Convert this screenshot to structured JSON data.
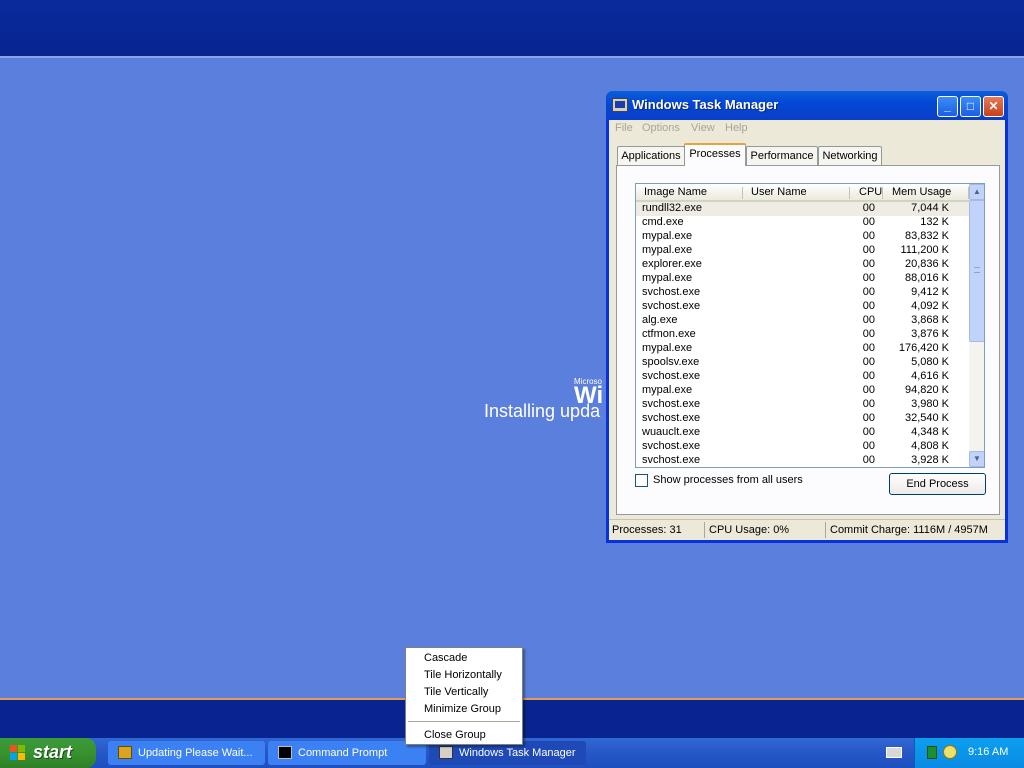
{
  "setup": {
    "brand": "Microso",
    "logo": "Wi",
    "status": "Installing upda"
  },
  "task_manager": {
    "title": "Windows Task Manager",
    "title_buttons": {
      "minimize": "_",
      "maximize": "□",
      "close": "✕"
    },
    "menu": [
      "File",
      "Options",
      "View",
      "Help"
    ],
    "tabs": [
      {
        "label": "Applications",
        "active": false
      },
      {
        "label": "Processes",
        "active": true
      },
      {
        "label": "Performance",
        "active": false
      },
      {
        "label": "Networking",
        "active": false
      }
    ],
    "columns": [
      "Image Name",
      "User Name",
      "CPU",
      "Mem Usage"
    ],
    "processes": [
      {
        "name": "rundll32.exe",
        "cpu": "00",
        "mem": "7,044 K"
      },
      {
        "name": "cmd.exe",
        "cpu": "00",
        "mem": "132 K"
      },
      {
        "name": "mypal.exe",
        "cpu": "00",
        "mem": "83,832 K"
      },
      {
        "name": "mypal.exe",
        "cpu": "00",
        "mem": "111,200 K"
      },
      {
        "name": "explorer.exe",
        "cpu": "00",
        "mem": "20,836 K"
      },
      {
        "name": "mypal.exe",
        "cpu": "00",
        "mem": "88,016 K"
      },
      {
        "name": "svchost.exe",
        "cpu": "00",
        "mem": "9,412 K"
      },
      {
        "name": "svchost.exe",
        "cpu": "00",
        "mem": "4,092 K"
      },
      {
        "name": "alg.exe",
        "cpu": "00",
        "mem": "3,868 K"
      },
      {
        "name": "ctfmon.exe",
        "cpu": "00",
        "mem": "3,876 K"
      },
      {
        "name": "mypal.exe",
        "cpu": "00",
        "mem": "176,420 K"
      },
      {
        "name": "spoolsv.exe",
        "cpu": "00",
        "mem": "5,080 K"
      },
      {
        "name": "svchost.exe",
        "cpu": "00",
        "mem": "4,616 K"
      },
      {
        "name": "mypal.exe",
        "cpu": "00",
        "mem": "94,820 K"
      },
      {
        "name": "svchost.exe",
        "cpu": "00",
        "mem": "3,980 K"
      },
      {
        "name": "svchost.exe",
        "cpu": "00",
        "mem": "32,540 K"
      },
      {
        "name": "wuauclt.exe",
        "cpu": "00",
        "mem": "4,348 K"
      },
      {
        "name": "svchost.exe",
        "cpu": "00",
        "mem": "4,808 K"
      },
      {
        "name": "svchost.exe",
        "cpu": "00",
        "mem": "3,928 K"
      }
    ],
    "scroll": {
      "up": "▲",
      "down": "▼"
    },
    "show_all_label": "Show processes from all users",
    "end_process_label": "End Process",
    "status": {
      "processes": "Processes: 31",
      "cpu": "CPU Usage: 0%",
      "commit": "Commit Charge: 1116M / 4957M"
    }
  },
  "context_menu": [
    "Cascade",
    "Tile Horizontally",
    "Tile Vertically",
    "Minimize Group",
    "Close Group"
  ],
  "taskbar": {
    "start_label": "start",
    "tasks": [
      {
        "label": "Updating Please Wait..."
      },
      {
        "label": "Command Prompt"
      },
      {
        "label": "Windows Task Manager"
      }
    ],
    "clock": "9:16 AM"
  },
  "colors": {
    "desktop": "#5b7fdd",
    "title_bar": "#0a5fd8",
    "start_button": "#3c9a3b",
    "taskbar": "#2657c6"
  }
}
